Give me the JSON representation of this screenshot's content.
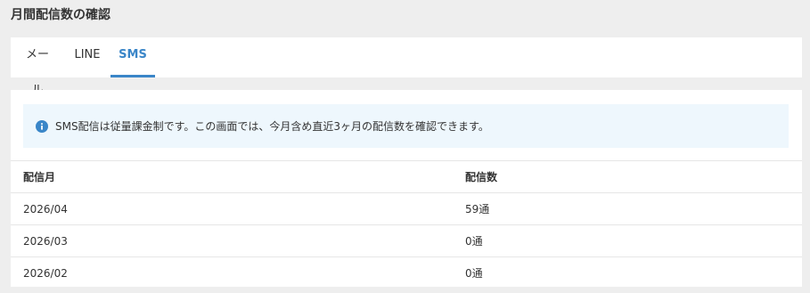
{
  "page": {
    "title": "月間配信数の確認"
  },
  "tabs": [
    {
      "label": "メール",
      "active": false
    },
    {
      "label": "LINE",
      "active": false
    },
    {
      "label": "SMS",
      "active": true
    }
  ],
  "notice": {
    "icon": "info-circle-icon",
    "text": "SMS配信は従量課金制です。この画面では、今月含め直近3ヶ月の配信数を確認できます。"
  },
  "table": {
    "headers": [
      "配信月",
      "配信数"
    ],
    "rows": [
      [
        "2026/04",
        "59通"
      ],
      [
        "2026/03",
        "0通"
      ],
      [
        "2026/02",
        "0通"
      ]
    ]
  },
  "colors": {
    "accent": "#3a86c8",
    "notice_bg": "#eef7fd",
    "page_bg": "#eeeeee"
  }
}
